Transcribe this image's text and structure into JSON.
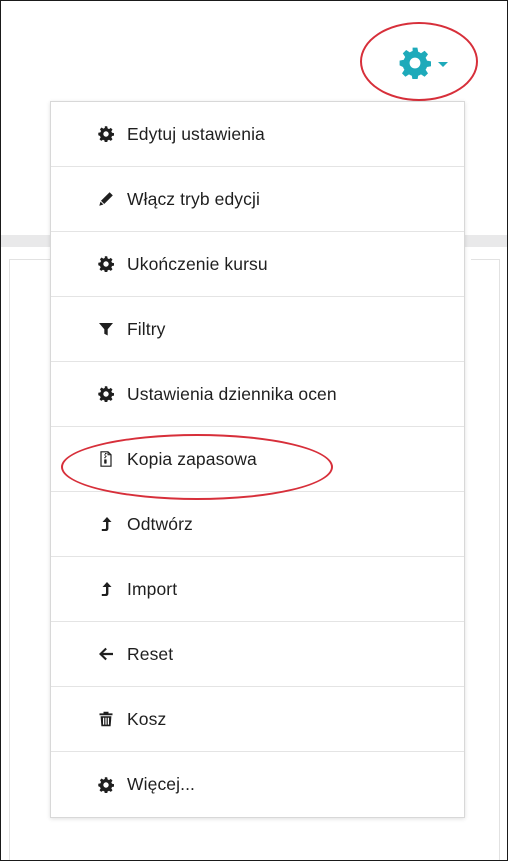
{
  "colors": {
    "accent": "#1eaaba",
    "annotation": "#d72f3a",
    "menu_text": "#1f1f1f",
    "icon": "#1f1f1f"
  },
  "settings_toggle": {
    "icon": "gear-icon",
    "dropdown_indicator": "caret-down-icon",
    "highlighted": true
  },
  "menu": {
    "items": [
      {
        "icon": "gear-icon",
        "label": "Edytuj ustawienia"
      },
      {
        "icon": "pencil-icon",
        "label": "Włącz tryb edycji"
      },
      {
        "icon": "gear-icon",
        "label": "Ukończenie kursu"
      },
      {
        "icon": "filter-icon",
        "label": "Filtry"
      },
      {
        "icon": "gear-icon",
        "label": "Ustawienia dziennika ocen"
      },
      {
        "icon": "archive-file-icon",
        "label": "Kopia zapasowa",
        "highlighted": true
      },
      {
        "icon": "upload-arrow-icon",
        "label": "Odtwórz"
      },
      {
        "icon": "upload-arrow-icon",
        "label": "Import"
      },
      {
        "icon": "arrow-left-icon",
        "label": "Reset"
      },
      {
        "icon": "trash-icon",
        "label": "Kosz"
      },
      {
        "icon": "gear-icon",
        "label": "Więcej..."
      }
    ]
  }
}
